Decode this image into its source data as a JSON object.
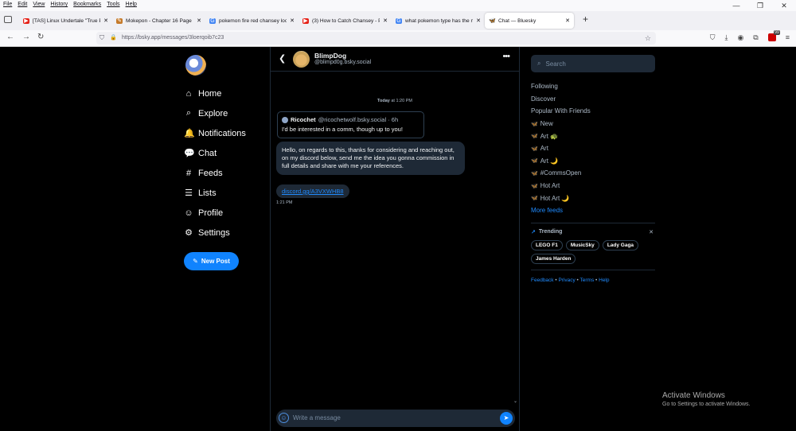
{
  "browser": {
    "menu": [
      "File",
      "Edit",
      "View",
      "History",
      "Bookmarks",
      "Tools",
      "Help"
    ],
    "tabs": [
      {
        "title": "[TAS] Linux Undertale \"True Paci",
        "color": "#e62117",
        "glyph": "▶"
      },
      {
        "title": "Mokepon - Chapter 16 Page 60",
        "color": "#c57a2a",
        "glyph": "✎"
      },
      {
        "title": "pokemon fire red chansey locat",
        "color": "#4285f4",
        "glyph": "G"
      },
      {
        "title": "(3) How to Catch Chansey - Poke",
        "color": "#e62117",
        "glyph": "▶"
      },
      {
        "title": "what pokemon type has the mos",
        "color": "#4285f4",
        "glyph": "G"
      },
      {
        "title": "Chat — Bluesky",
        "color": "#1083fe",
        "glyph": "🦋",
        "active": true
      }
    ],
    "url": "https://bsky.app/messages/3loerqoib7c23",
    "ext_badge": "99"
  },
  "sidebar": {
    "items": [
      {
        "label": "Home",
        "icon": "⌂"
      },
      {
        "label": "Explore",
        "icon": "⌕"
      },
      {
        "label": "Notifications",
        "icon": "🔔"
      },
      {
        "label": "Chat",
        "icon": "💬"
      },
      {
        "label": "Feeds",
        "icon": "#"
      },
      {
        "label": "Lists",
        "icon": "☰"
      },
      {
        "label": "Profile",
        "icon": "☺"
      },
      {
        "label": "Settings",
        "icon": "⚙"
      }
    ],
    "new_post": "New Post"
  },
  "chat": {
    "name": "BlimpDog",
    "handle": "@blimpd0g.bsky.social",
    "day_label": "Today",
    "day_time": " at 1:20 PM",
    "quote": {
      "author": "Ricochet",
      "meta": "@ricochetwolf.bsky.social · 6h",
      "text": "I'd be interested in a comm, though up to you!"
    },
    "message": "Hello, on regards to this, thanks for considering and reaching out, on my discord below, send me the idea you gonna commission in full details and share with me your references.",
    "link": "discord.gg/A3VXWHB8",
    "msg_time": "1:21 PM",
    "composer_placeholder": "Write a message"
  },
  "right": {
    "search_placeholder": "Search",
    "feeds": [
      {
        "label": "Following",
        "bf": false
      },
      {
        "label": "Discover",
        "bf": false
      },
      {
        "label": "Popular With Friends",
        "bf": false
      },
      {
        "label": "New",
        "bf": true
      },
      {
        "label": "Art 🐢",
        "bf": true
      },
      {
        "label": "Art",
        "bf": true
      },
      {
        "label": "Art 🌙",
        "bf": true
      },
      {
        "label": "#CommsOpen",
        "bf": true
      },
      {
        "label": "Hot Art",
        "bf": true
      },
      {
        "label": "Hot Art 🌙",
        "bf": true
      }
    ],
    "more_feeds": "More feeds",
    "trending_title": "Trending",
    "trends": [
      "LEGO F1",
      "MusicSky",
      "Lady Gaga",
      "James Harden"
    ],
    "footer": [
      "Feedback",
      "Privacy",
      "Terms",
      "Help"
    ]
  },
  "watermark": {
    "line1": "Activate Windows",
    "line2": "Go to Settings to activate Windows."
  }
}
